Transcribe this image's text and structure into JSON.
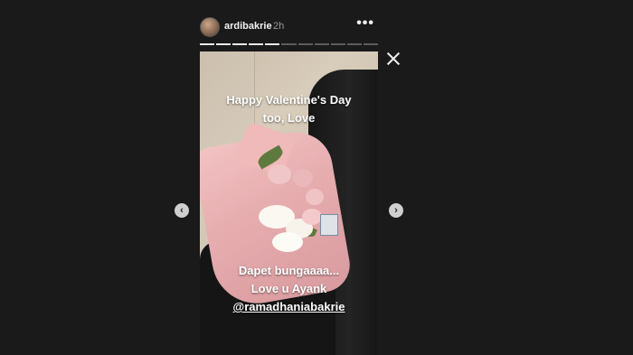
{
  "header": {
    "username": "ardibakrie",
    "time": "2h",
    "more_icon": "more-dots-icon"
  },
  "progress": {
    "total_segments": 11,
    "completed_segments": 5
  },
  "story": {
    "caption_top_line1": "Happy Valentine's Day",
    "caption_top_line2": "too, Love",
    "caption_bottom_line1": "Dapet bungaaaa...",
    "caption_bottom_line2": "Love u Ayank",
    "mention": "@ramadhaniabakrie"
  },
  "controls": {
    "close_icon": "close-icon",
    "prev_icon": "chevron-left-icon",
    "next_icon": "chevron-right-icon"
  }
}
